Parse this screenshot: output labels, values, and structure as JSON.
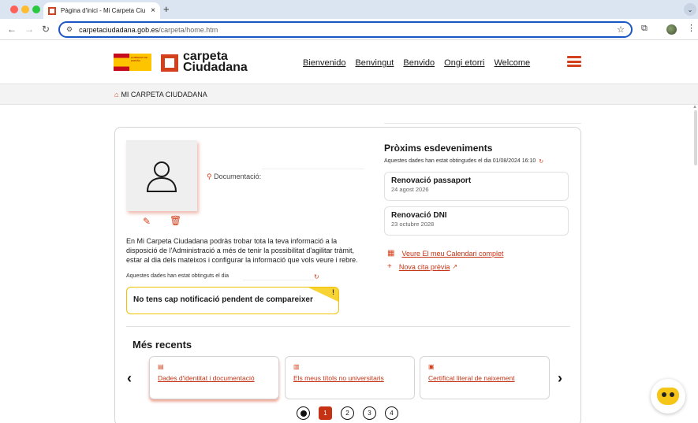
{
  "browser": {
    "tab_title": "Pàgina d'inici - Mi Carpeta Ciu",
    "tab_close": "×",
    "new_tab": "+",
    "url_host": "carpetaciudadana.gob.es",
    "url_path": "/carpeta/home.htm",
    "icons": {
      "back": "←",
      "forward": "→",
      "reload": "↻",
      "star": "☆",
      "extensions": "⧉",
      "menu": "⋮",
      "tab_menu": "⌄",
      "site_info": "⚙"
    },
    "traffic_colors": [
      "#fe5f57",
      "#febc2e",
      "#28c840"
    ]
  },
  "header": {
    "brand_line1": "carpeta",
    "brand_line2": "Ciudadana",
    "gov_logo_text": "GOBIERNO DE ESPAÑA",
    "languages": [
      "Bienvenido",
      "Benvingut",
      "Benvido",
      "Ongi etorri",
      "Welcome"
    ],
    "accent_color": "#d2401c"
  },
  "breadcrumb": {
    "home_icon": "⌂",
    "label": "MI CARPETA CIUDADANA"
  },
  "profile": {
    "documentation_label": "Documentació:",
    "edit_icon": "✎",
    "delete_icon": "🗑",
    "intro": "En Mi Carpeta Ciudadana podràs trobar tota la teva informació a la disposició de l'Administració a més de tenir la possibilitat d'agilitar tràmit, estar al dia dels mateixos i configurar la informació que vols veure i rebre.",
    "obtained_text": "Aquestes dades han estat obtinguts el dia",
    "refresh_icon": "↻",
    "notification": "No tens cap notificació pendent de compareixer",
    "notification_badge": "!"
  },
  "events": {
    "title": "Pròxims esdeveniments",
    "obtained_text": "Aquestes dades han estat obtingudes el dia 01/08/2024 16:10",
    "refresh_icon": "↻",
    "items": [
      {
        "name": "Renovació passaport",
        "date": "24 agost 2026"
      },
      {
        "name": "Renovació DNI",
        "date": "23 octubre 2028"
      }
    ],
    "calendar_icon": "▦",
    "calendar_link": "Veure El meu Calendari complet",
    "new_appointment_icon": "+",
    "new_appointment_link": "Nova cita prèvia",
    "external_icon": "↗"
  },
  "recent": {
    "title": "Més recents",
    "prev_arrow": "‹",
    "next_arrow": "›",
    "cards": [
      {
        "icon": "▤",
        "label": "Dades d'identitat i documentació"
      },
      {
        "icon": "▥",
        "label": "Els meus títols no universitaris"
      },
      {
        "icon": "▣",
        "label": "Certificat literal de naixement"
      }
    ],
    "pages": [
      "1",
      "2",
      "3",
      "4"
    ],
    "current_page": "1"
  }
}
